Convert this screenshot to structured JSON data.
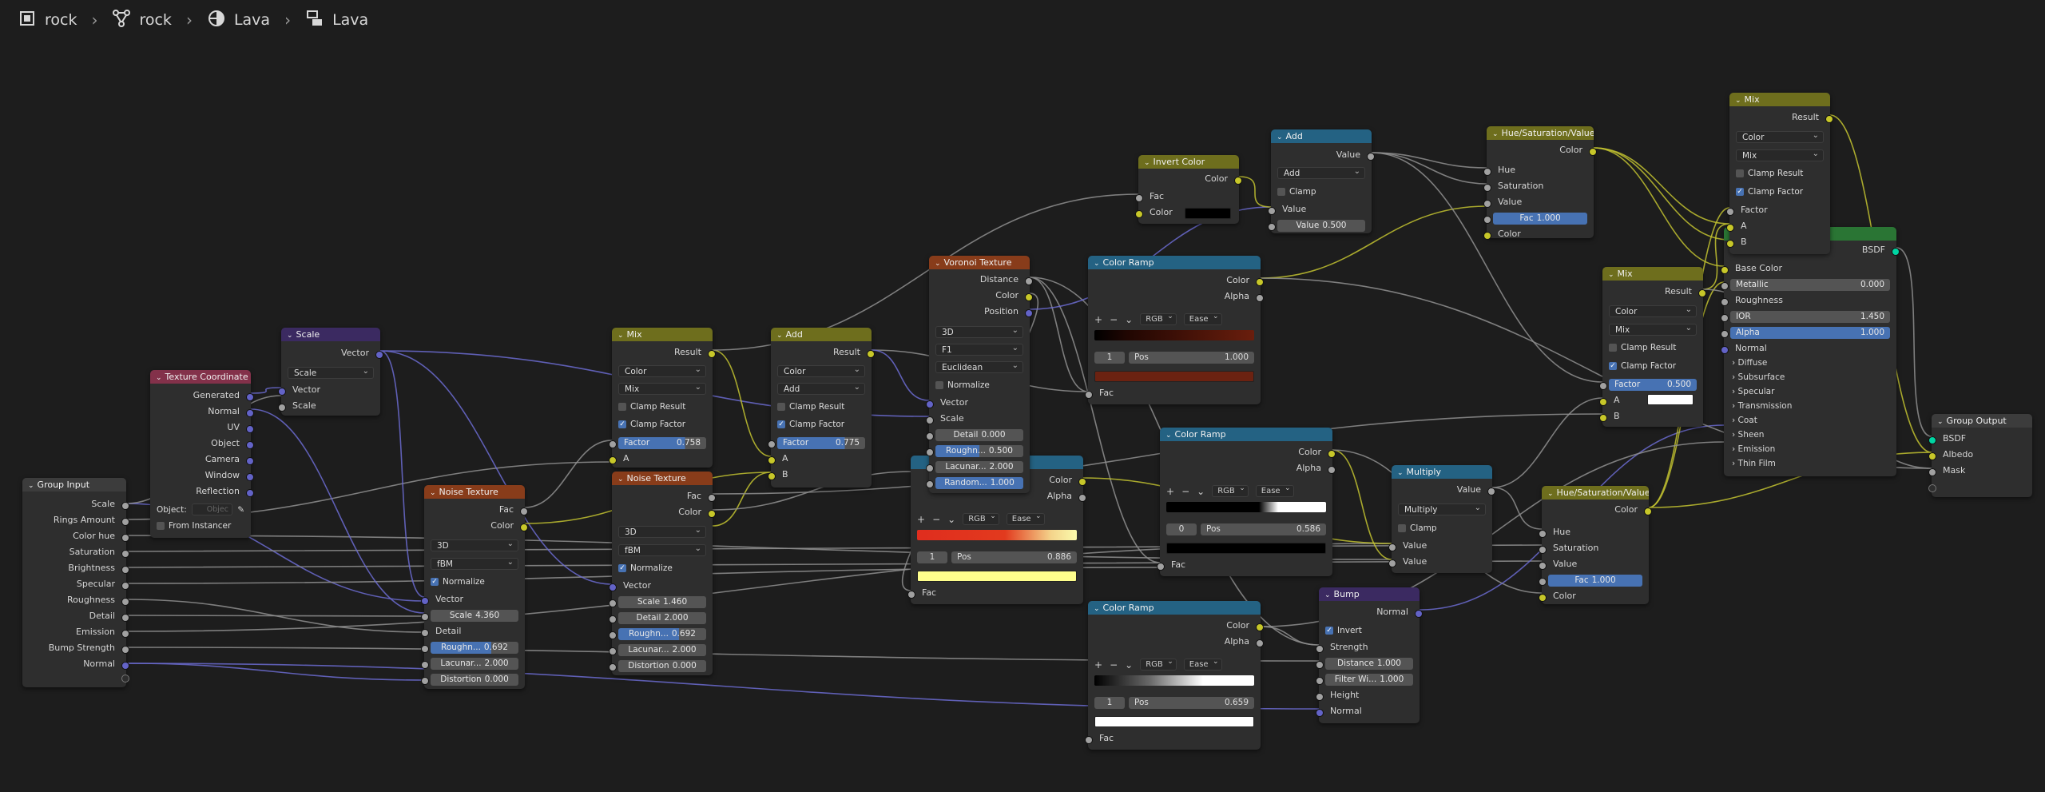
{
  "breadcrumb": [
    {
      "label": "rock",
      "icon": "object-icon"
    },
    {
      "label": "rock",
      "icon": "nodegroup-icon"
    },
    {
      "label": "Lava",
      "icon": "material-icon"
    },
    {
      "label": "Lava",
      "icon": "nodetree-icon"
    }
  ],
  "group_input": {
    "title": "Group Input",
    "outputs": [
      "Scale",
      "Rings Amount",
      "Color hue",
      "Saturation",
      "Brightness",
      "Specular",
      "Roughness",
      "Detail",
      "Emission",
      "Bump Strength",
      "Normal"
    ]
  },
  "tex_coord": {
    "title": "Texture Coordinate",
    "outputs": [
      "Generated",
      "Normal",
      "UV",
      "Object",
      "Camera",
      "Window",
      "Reflection"
    ],
    "object_label": "Object:",
    "object_placeholder": "Objec",
    "from_instancer": "From Instancer"
  },
  "scale_node": {
    "title": "Scale",
    "out": "Vector",
    "mode": "Scale",
    "in1": "Vector",
    "in2": "Scale"
  },
  "noise1": {
    "title": "Noise Texture",
    "out1": "Fac",
    "out2": "Color",
    "dim": "3D",
    "type": "fBM",
    "normalize": "Normalize",
    "vector": "Vector",
    "scale_label": "Scale",
    "scale_val": "4.360",
    "detail": "Detail",
    "rough_label": "Roughn...",
    "rough_val": "0.692",
    "lac_label": "Lacunar...",
    "lac_val": "2.000",
    "dist_label": "Distortion",
    "dist_val": "0.000"
  },
  "mix1": {
    "title": "Mix",
    "out": "Result",
    "dtype": "Color",
    "blend": "Mix",
    "clamp_result": "Clamp Result",
    "clamp_factor": "Clamp Factor",
    "factor_label": "Factor",
    "factor_val": "0.758",
    "a": "A"
  },
  "noise2": {
    "title": "Noise Texture",
    "out1": "Fac",
    "out2": "Color",
    "dim": "3D",
    "type": "fBM",
    "normalize": "Normalize",
    "vector": "Vector",
    "scale_label": "Scale",
    "scale_val": "1.460",
    "detail_label": "Detail",
    "detail_val": "2.000",
    "rough_label": "Roughn...",
    "rough_val": "0.692",
    "lac_label": "Lacunar...",
    "lac_val": "2.000",
    "dist_label": "Distortion",
    "dist_val": "0.000"
  },
  "add1": {
    "title": "Add",
    "out": "Result",
    "dtype": "Color",
    "blend": "Add",
    "clamp_result": "Clamp Result",
    "clamp_factor": "Clamp Factor",
    "factor_label": "Factor",
    "factor_val": "0.775",
    "a": "A",
    "b": "B"
  },
  "voronoi": {
    "title": "Voronoi Texture",
    "out1": "Distance",
    "out2": "Color",
    "out3": "Position",
    "dim": "3D",
    "feature": "F1",
    "metric": "Euclidean",
    "normalize": "Normalize",
    "vector": "Vector",
    "scale": "Scale",
    "detail_label": "Detail",
    "detail_val": "0.000",
    "rough_label": "Roughn...",
    "rough_val": "0.500",
    "lac_label": "Lacunar...",
    "lac_val": "2.000",
    "rand_label": "Random...",
    "rand_val": "1.000"
  },
  "ramp_mid": {
    "out1": "Color",
    "out2": "Alpha",
    "mode": "RGB",
    "interp": "Ease",
    "index": "1",
    "pos_label": "Pos",
    "pos_val": "0.886",
    "fac": "Fac"
  },
  "ramp_top": {
    "title": "Color Ramp",
    "out1": "Color",
    "out2": "Alpha",
    "mode": "RGB",
    "interp": "Ease",
    "index": "1",
    "pos_label": "Pos",
    "pos_val": "1.000",
    "fac": "Fac"
  },
  "ramp_c": {
    "title": "Color Ramp",
    "out1": "Color",
    "out2": "Alpha",
    "mode": "RGB",
    "interp": "Ease",
    "index": "0",
    "pos_label": "Pos",
    "pos_val": "0.586",
    "fac": "Fac"
  },
  "ramp_bot": {
    "title": "Color Ramp",
    "out1": "Color",
    "out2": "Alpha",
    "mode": "RGB",
    "interp": "Ease",
    "index": "1",
    "pos_label": "Pos",
    "pos_val": "0.659",
    "fac": "Fac"
  },
  "invert": {
    "title": "Invert Color",
    "out": "Color",
    "fac": "Fac",
    "color": "Color"
  },
  "math_add": {
    "title": "Add",
    "out": "Value",
    "op": "Add",
    "clamp": "Clamp",
    "value": "Value",
    "value_label": "Value",
    "value_val": "0.500"
  },
  "hsv1": {
    "title": "Hue/Saturation/Value",
    "out": "Color",
    "hue": "Hue",
    "sat": "Saturation",
    "val": "Value",
    "fac_label": "Fac",
    "fac_val": "1.000",
    "color": "Color"
  },
  "multiply": {
    "title": "Multiply",
    "out": "Value",
    "op": "Multiply",
    "clamp": "Clamp",
    "v1": "Value",
    "v2": "Value"
  },
  "bump": {
    "title": "Bump",
    "out": "Normal",
    "invert": "Invert",
    "strength": "Strength",
    "dist_label": "Distance",
    "dist_val": "1.000",
    "filter_label": "Filter Wi...",
    "filter_val": "1.000",
    "height": "Height",
    "normal": "Normal"
  },
  "hsv2": {
    "title": "Hue/Saturation/Value",
    "out": "Color",
    "hue": "Hue",
    "sat": "Saturation",
    "val": "Value",
    "fac_label": "Fac",
    "fac_val": "1.000",
    "color": "Color"
  },
  "mix_top": {
    "title": "Mix",
    "out": "Result",
    "dtype": "Color",
    "blend": "Mix",
    "clamp_result": "Clamp Result",
    "clamp_factor": "Clamp Factor",
    "factor": "Factor",
    "a": "A",
    "b": "B"
  },
  "mix_mid": {
    "title": "Mix",
    "out": "Result",
    "dtype": "Color",
    "blend": "Mix",
    "clamp_result": "Clamp Result",
    "clamp_factor": "Clamp Factor",
    "factor_label": "Factor",
    "factor_val": "0.500",
    "a": "A",
    "b": "B"
  },
  "bsdf": {
    "out": "BSDF",
    "base_color": "Base Color",
    "metallic_label": "Metallic",
    "metallic_val": "0.000",
    "roughness": "Roughness",
    "ior_label": "IOR",
    "ior_val": "1.450",
    "alpha_label": "Alpha",
    "alpha_val": "1.000",
    "normal": "Normal",
    "panels": [
      "Diffuse",
      "Subsurface",
      "Specular",
      "Transmission",
      "Coat",
      "Sheen",
      "Emission",
      "Thin Film"
    ]
  },
  "group_output": {
    "title": "Group Output",
    "inputs": [
      "BSDF",
      "Albedo",
      "Mask"
    ]
  },
  "colors": {
    "background": "#1d1d1d",
    "node_body": "#2e2e2e",
    "socket_float": "#a1a1a1",
    "socket_color": "#c7c729",
    "socket_vector": "#6363c7",
    "socket_shader": "#00d6a3",
    "field_blue": "#4772b3"
  }
}
